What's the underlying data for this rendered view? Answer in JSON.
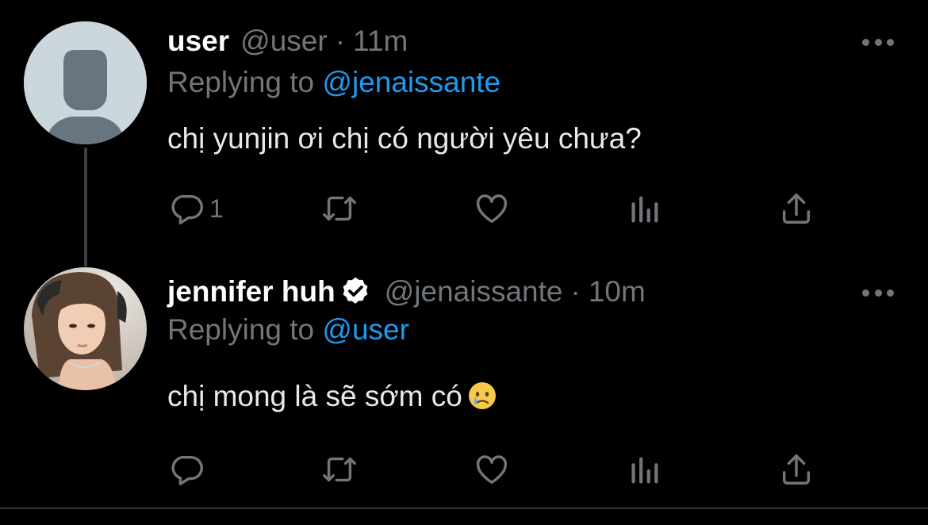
{
  "tweets": [
    {
      "display_name": "user",
      "handle": "@user",
      "separator": "·",
      "time": "11m",
      "replying_prefix": "Replying to ",
      "replying_to": "@jenaissante",
      "text": "chị yunjin ơi chị có người yêu chưa?",
      "reply_count": "1",
      "avatar": "default-profile-avatar"
    },
    {
      "display_name": "jennifer huh",
      "handle": "@jenaissante",
      "separator": "·",
      "time": "10m",
      "replying_prefix": "Replying to ",
      "replying_to": "@user",
      "text": "chị mong là sẽ sớm có",
      "reply_count": "",
      "verified": true,
      "text_emoji": "face-holding-back-tears-emoji",
      "avatar": "profile-photo"
    }
  ],
  "icons": [
    "reply-icon",
    "retweet-icon",
    "like-icon",
    "analytics-icon",
    "share-icon",
    "more-icon",
    "verified-icon"
  ],
  "colors": {
    "background": "#000000",
    "text": "#e7e9ea",
    "secondary": "#71767b",
    "link": "#1d9bf0"
  }
}
